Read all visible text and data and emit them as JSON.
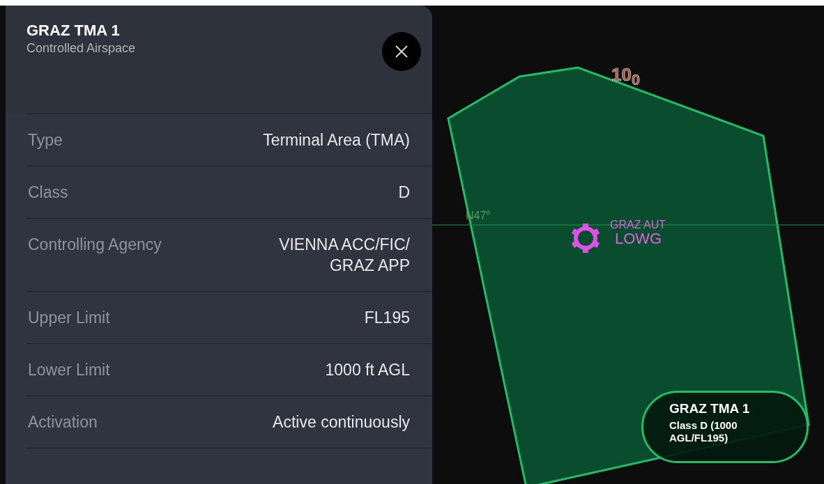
{
  "panel": {
    "title": "GRAZ TMA 1",
    "subtitle": "Controlled Airspace",
    "rows": [
      {
        "label": "Type",
        "value": [
          "Terminal Area (TMA)"
        ]
      },
      {
        "label": "Class",
        "value": [
          "D"
        ]
      },
      {
        "label": "Controlling Agency",
        "value": [
          "VIENNA ACC/FIC/",
          "GRAZ APP"
        ]
      },
      {
        "label": "Upper Limit",
        "value": [
          "FL195"
        ]
      },
      {
        "label": "Lower Limit",
        "value": [
          "1000 ft AGL"
        ]
      },
      {
        "label": "Activation",
        "value": [
          "Active continuously"
        ]
      }
    ]
  },
  "map": {
    "altitude_label": "10$_{0}$",
    "latitude_label": "N47°",
    "airport": {
      "name": "GRAZ AUT",
      "code": "LOWG"
    },
    "airspace_label": {
      "title": "GRAZ TMA 1",
      "detail": [
        "Class D (1000",
        "AGL/FL195)"
      ]
    }
  }
}
